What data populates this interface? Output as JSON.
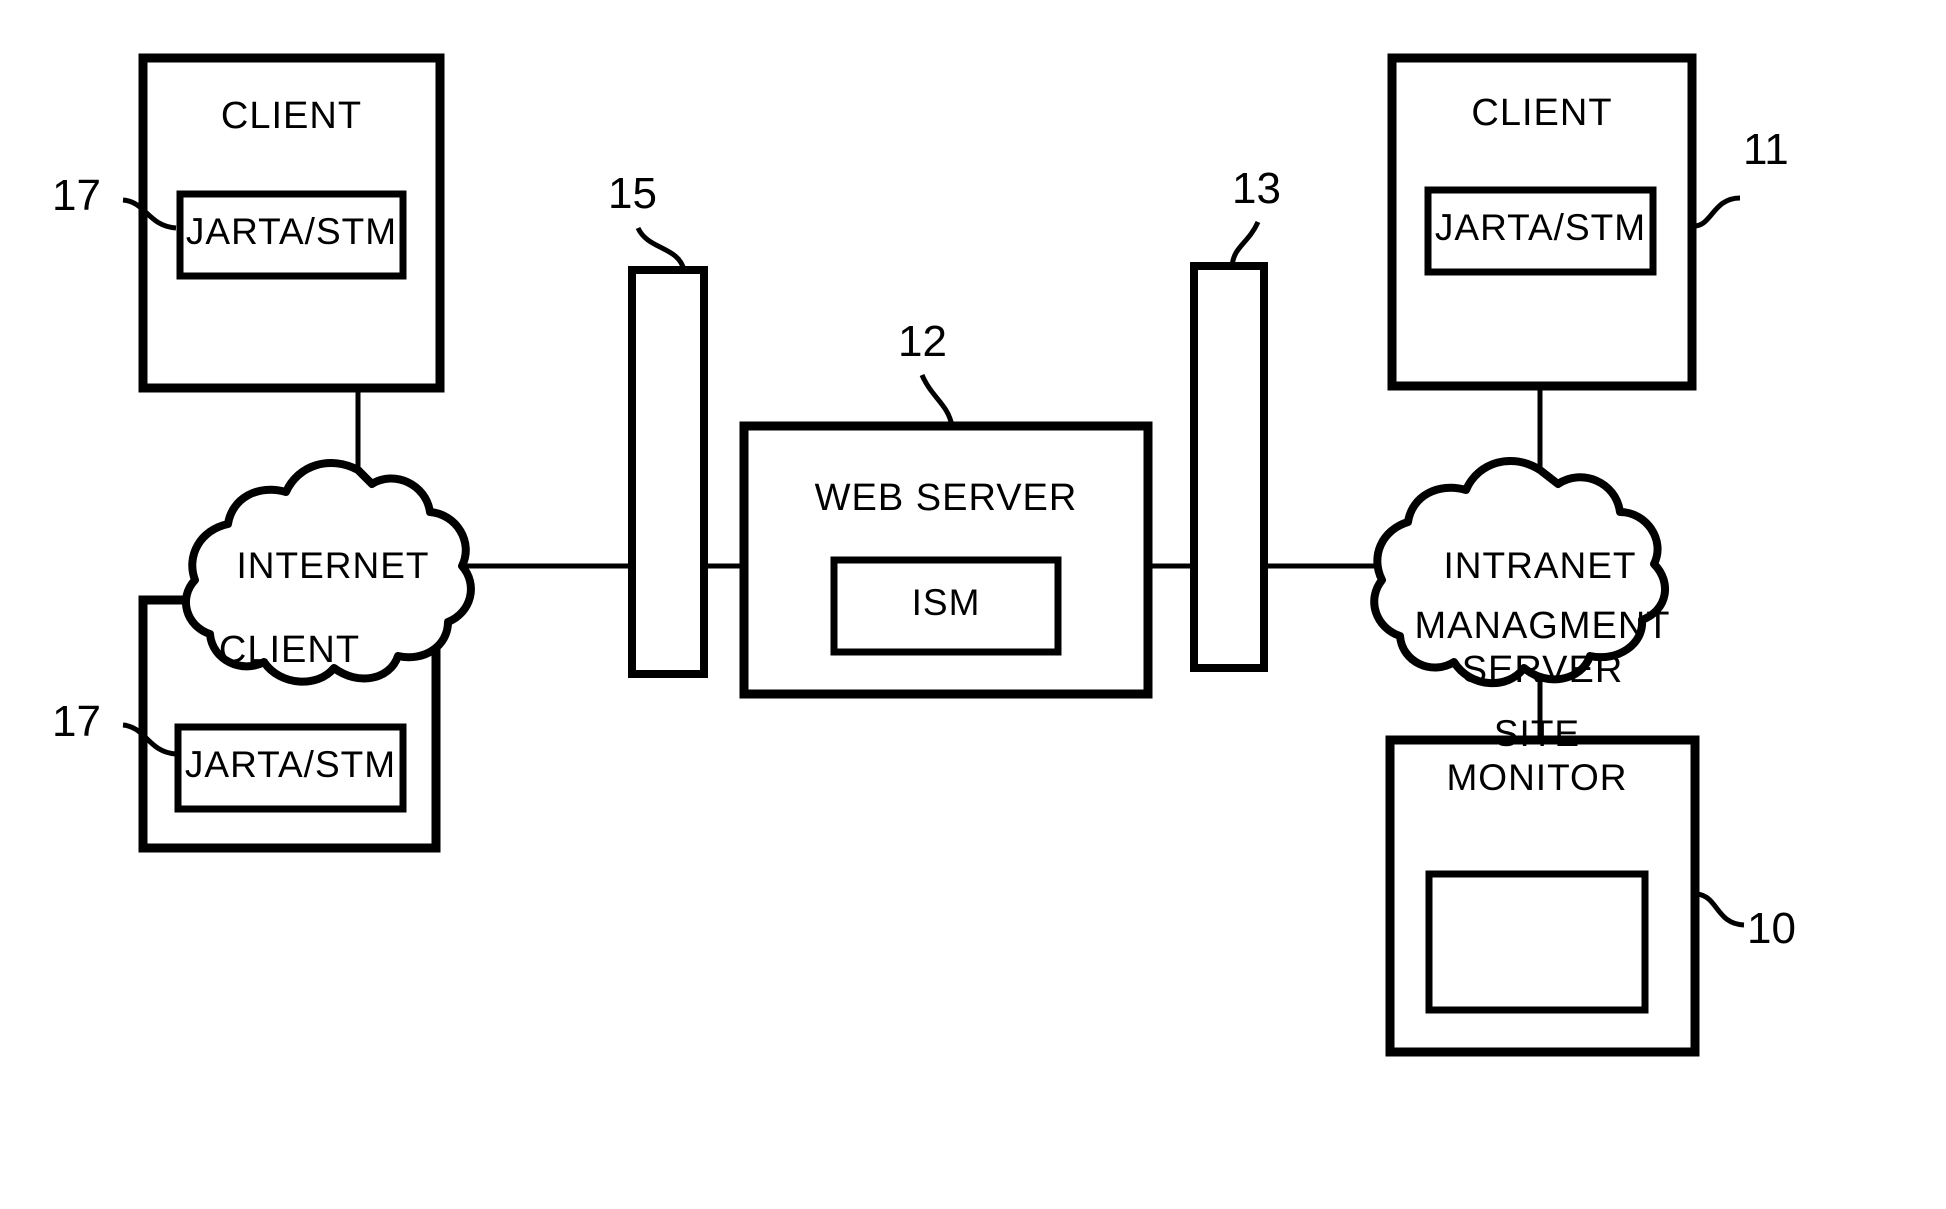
{
  "figure": {
    "type": "network-architecture-block-diagram",
    "stroke_color": "#000000",
    "background_color": "#ffffff"
  },
  "nodes": {
    "client_top_left": {
      "label": "CLIENT",
      "module_label": "JARTA/STM",
      "ref": "17"
    },
    "client_bottom_left": {
      "label": "CLIENT",
      "module_label": "JARTA/STM",
      "ref": "17"
    },
    "client_top_right": {
      "label": "CLIENT",
      "module_label": "JARTA/STM",
      "ref": "11"
    },
    "management_server": {
      "label_line1": "MANAGMENT",
      "label_line2": "SERVER",
      "module_line1": "SITE",
      "module_line2": "MONITOR",
      "ref": "10"
    },
    "web_server": {
      "label": "WEB SERVER",
      "module_label": "ISM",
      "ref": "12"
    },
    "internet_cloud": {
      "label": "INTERNET"
    },
    "intranet_cloud": {
      "label": "INTRANET"
    },
    "firewall_left": {
      "label": "",
      "ref": "15"
    },
    "firewall_right": {
      "label": "",
      "ref": "13"
    }
  },
  "reference_numerals": [
    {
      "id": "ref-17-top",
      "value": "17"
    },
    {
      "id": "ref-17-bottom",
      "value": "17"
    },
    {
      "id": "ref-15",
      "value": "15"
    },
    {
      "id": "ref-12",
      "value": "12"
    },
    {
      "id": "ref-13",
      "value": "13"
    },
    {
      "id": "ref-11",
      "value": "11"
    },
    {
      "id": "ref-10",
      "value": "10"
    }
  ],
  "connections": [
    {
      "from": "client_top_left",
      "to": "internet_cloud"
    },
    {
      "from": "client_bottom_left",
      "to": "internet_cloud"
    },
    {
      "from": "internet_cloud",
      "to": "firewall_left"
    },
    {
      "from": "firewall_left",
      "to": "web_server"
    },
    {
      "from": "web_server",
      "to": "firewall_right"
    },
    {
      "from": "firewall_right",
      "to": "intranet_cloud"
    },
    {
      "from": "intranet_cloud",
      "to": "client_top_right"
    },
    {
      "from": "intranet_cloud",
      "to": "management_server"
    }
  ]
}
